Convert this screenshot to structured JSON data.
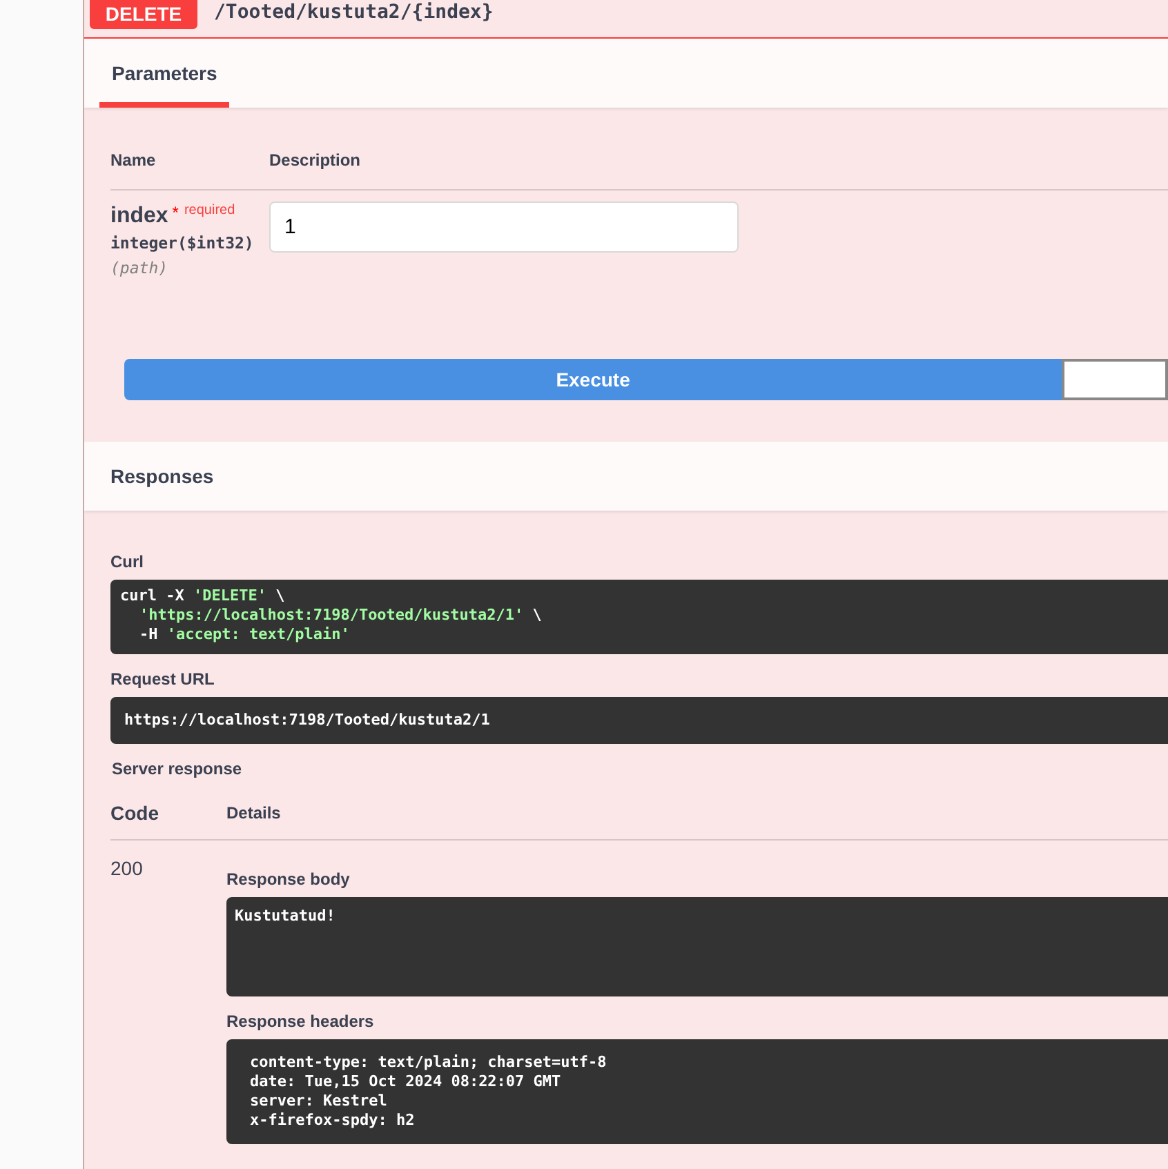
{
  "operation": {
    "method": "DELETE",
    "path": "/Tooted/kustuta2/{index}"
  },
  "tabs": [
    {
      "label": "Parameters",
      "selected": true
    }
  ],
  "parameters": {
    "columns": [
      "Name",
      "Description"
    ],
    "rows": [
      {
        "name": "index",
        "required_mark": "*",
        "required": "required",
        "type": "integer($int32)",
        "location": "(path)",
        "value": "1"
      }
    ]
  },
  "execute": {
    "label": "Execute"
  },
  "responses_title": "Responses",
  "curl": {
    "label": "Curl",
    "lines": [
      {
        "indented": false,
        "tokens": [
          {
            "kind": "plain",
            "text": "curl -X "
          },
          {
            "kind": "string",
            "text": "'DELETE'"
          },
          {
            "kind": "plain",
            "text": " \\"
          }
        ]
      },
      {
        "indented": true,
        "tokens": [
          {
            "kind": "string",
            "text": "'https://localhost:7198/Tooted/kustuta2/1'"
          },
          {
            "kind": "plain",
            "text": " \\"
          }
        ]
      },
      {
        "indented": true,
        "tokens": [
          {
            "kind": "plain",
            "text": "-H "
          },
          {
            "kind": "string",
            "text": "'accept: text/plain'"
          }
        ]
      }
    ]
  },
  "request_url": {
    "label": "Request URL",
    "value": "https://localhost:7198/Tooted/kustuta2/1"
  },
  "server_response": {
    "label": "Server response",
    "columns": [
      "Code",
      "Details"
    ],
    "code": "200",
    "body_label": "Response body",
    "body": "Kustutatud!",
    "headers_label": "Response headers",
    "headers": [
      "content-type: text/plain; charset=utf-8",
      "date: Tue,15 Oct 2024 08:22:07 GMT",
      "server: Kestrel",
      "x-firefox-spdy: h2"
    ]
  }
}
